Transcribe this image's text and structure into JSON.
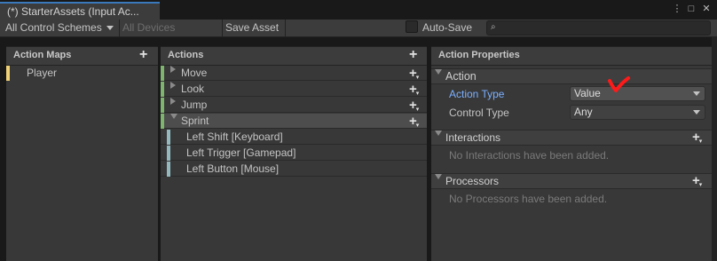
{
  "window": {
    "tab_title": "(*) StarterAssets (Input Ac...",
    "controls": [
      "⋮",
      "□",
      "✕"
    ]
  },
  "toolbar": {
    "control_schemes": "All Control Schemes",
    "devices": "All Devices",
    "save_asset": "Save Asset",
    "auto_save": "Auto-Save",
    "search_placeholder": ""
  },
  "action_maps": {
    "header": "Action Maps",
    "items": [
      {
        "label": "Player",
        "color": "#f0d176"
      }
    ]
  },
  "actions": {
    "header": "Actions",
    "items": [
      {
        "label": "Move",
        "color": "#7fb56e"
      },
      {
        "label": "Look",
        "color": "#7fb56e"
      },
      {
        "label": "Jump",
        "color": "#7fb56e"
      },
      {
        "label": "Sprint",
        "color": "#7fb56e"
      }
    ],
    "bindings": [
      {
        "label": "Left Shift [Keyboard]",
        "color": "#93b8bd"
      },
      {
        "label": "Left Trigger [Gamepad]",
        "color": "#93b8bd"
      },
      {
        "label": "Left Button [Mouse]",
        "color": "#93b8bd"
      }
    ]
  },
  "properties": {
    "header": "Action Properties",
    "action_section": "Action",
    "action_type_label": "Action Type",
    "action_type_value": "Value",
    "control_type_label": "Control Type",
    "control_type_value": "Any",
    "interactions_section": "Interactions",
    "interactions_empty": "No Interactions have been added.",
    "processors_section": "Processors",
    "processors_empty": "No Processors have been added."
  },
  "colors": {
    "accent_blue": "#7cb0ff",
    "annotation_red": "#ff1a1a"
  }
}
